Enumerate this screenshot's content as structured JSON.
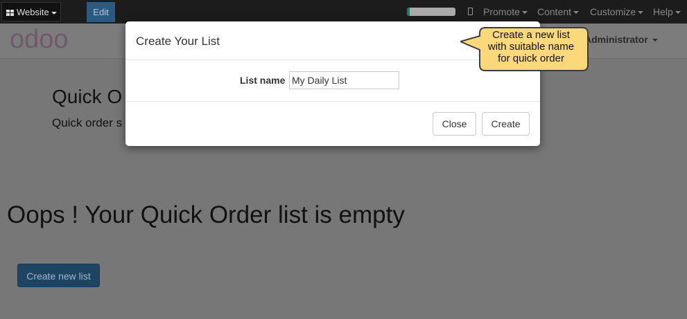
{
  "topbar": {
    "website_label": "Website",
    "edit_label": "Edit",
    "progress_fraction": 0.05,
    "menus": [
      "Promote",
      "Content",
      "Customize",
      "Help"
    ]
  },
  "header": {
    "logo_text": "odoo",
    "user_name": "Administrator"
  },
  "page": {
    "title": "Quick O",
    "subtitle": "Quick order s",
    "empty_message": "Oops ! Your Quick Order list is empty",
    "create_new_list_label": "Create new list"
  },
  "modal": {
    "title": "Create Your List",
    "field_label": "List name",
    "field_value": "My Daily List",
    "close_label": "Close",
    "create_label": "Create"
  },
  "callout": {
    "lines": [
      "Create a new list",
      "with suitable name",
      "for quick order"
    ]
  },
  "colors": {
    "topbar_bg": "#1c1c1c",
    "edit_bg": "#2a5a80",
    "logo_purple": "#875a7b",
    "logo_grey": "#8f8f8f",
    "callout_fill": "#fbd87a",
    "callout_stroke": "#3c3c3c",
    "primary_button": "#1e4463"
  }
}
